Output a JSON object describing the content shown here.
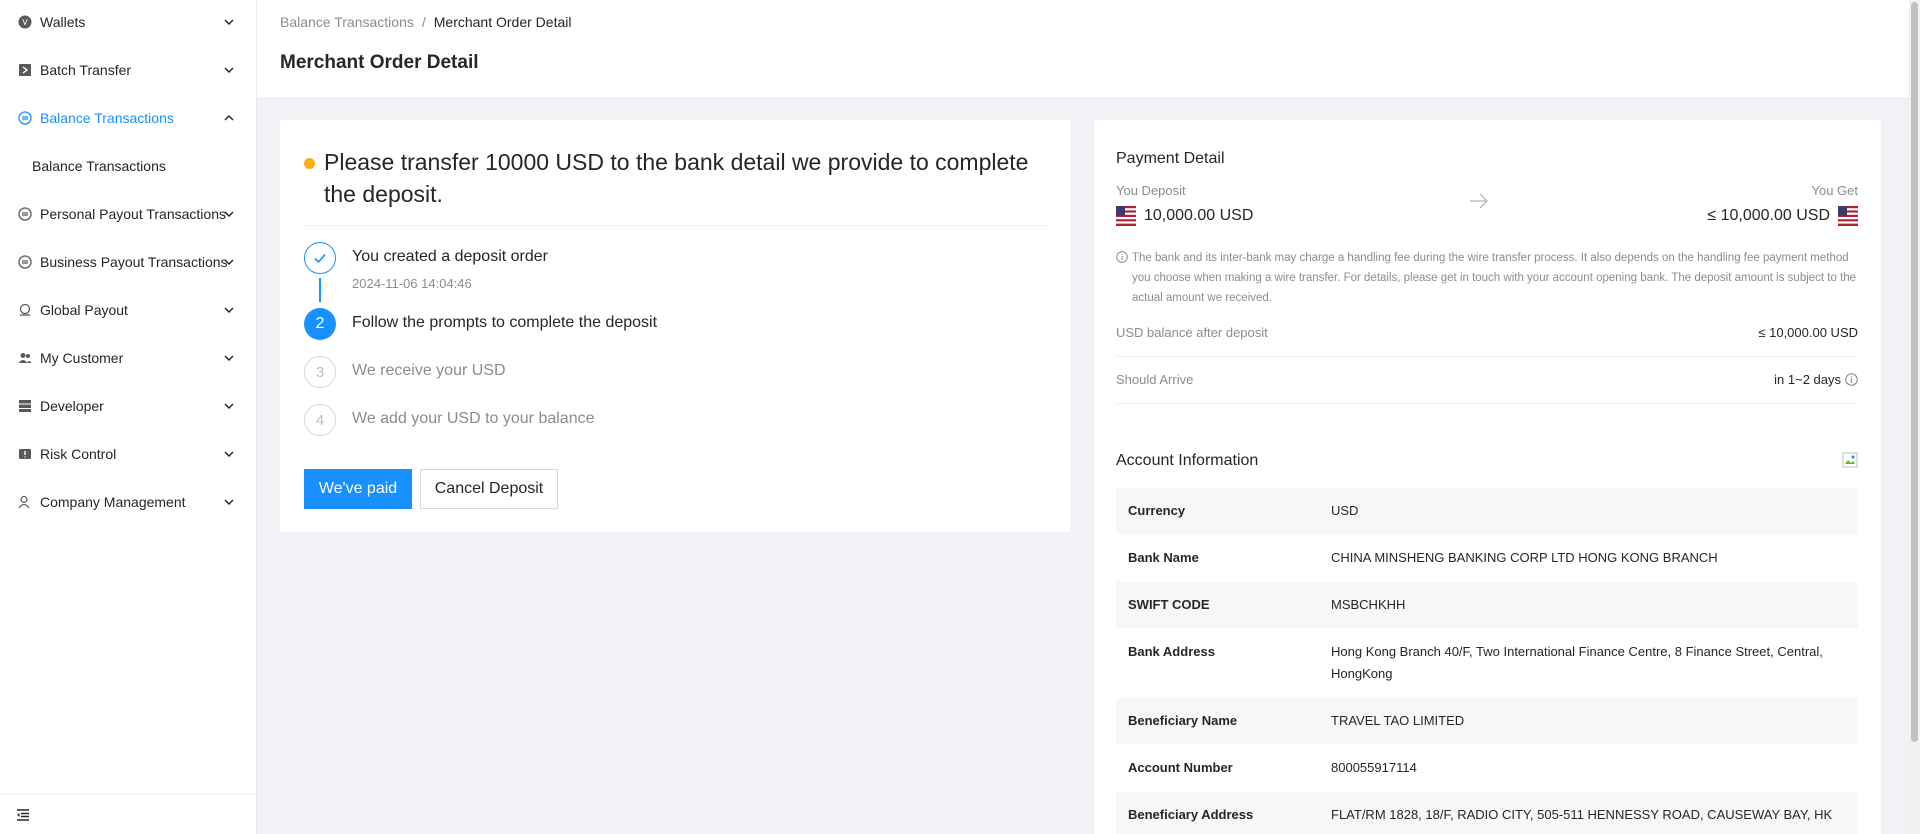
{
  "sidebar": {
    "items": [
      {
        "label": "Wallets",
        "icon": "wallet-icon"
      },
      {
        "label": "Batch Transfer",
        "icon": "batch-transfer-icon"
      },
      {
        "label": "Balance Transactions",
        "icon": "balance-icon",
        "active": true
      },
      {
        "label": "Personal Payout Transactions",
        "icon": "personal-payout-icon"
      },
      {
        "label": "Business Payout Transactions",
        "icon": "business-payout-icon"
      },
      {
        "label": "Global Payout",
        "icon": "global-payout-icon"
      },
      {
        "label": "My Customer",
        "icon": "customer-icon"
      },
      {
        "label": "Developer",
        "icon": "developer-icon"
      },
      {
        "label": "Risk Control",
        "icon": "risk-control-icon"
      },
      {
        "label": "Company Management",
        "icon": "company-icon"
      }
    ],
    "sub_item": "Balance Transactions"
  },
  "breadcrumb": {
    "parent": "Balance Transactions",
    "separator": "/",
    "current": "Merchant Order Detail"
  },
  "page_title": "Merchant Order Detail",
  "deposit": {
    "notice": "Please transfer 10000 USD to the bank detail we provide to complete the deposit.",
    "steps": [
      {
        "num": "1",
        "title": "You created a deposit order",
        "desc": "2024-11-06 14:04:46",
        "status": "done"
      },
      {
        "num": "2",
        "title": "Follow the prompts to complete the deposit",
        "status": "process"
      },
      {
        "num": "3",
        "title": "We receive your USD",
        "status": "wait"
      },
      {
        "num": "4",
        "title": "We add your USD to your balance",
        "status": "wait"
      }
    ],
    "paid_label": "We've paid",
    "cancel_label": "Cancel Deposit"
  },
  "payment": {
    "title": "Payment Detail",
    "you_deposit_label": "You Deposit",
    "you_deposit_value": "10,000.00 USD",
    "you_get_label": "You Get",
    "you_get_value": "≤ 10,000.00 USD",
    "fee_note": "The bank and its inter-bank may charge a handling fee during the wire transfer process. It also depends on the handling fee payment method you choose when making a wire transfer. For details, please get in touch with your account opening bank. The deposit amount is subject to the actual amount we received.",
    "balance_after_label": "USD balance after deposit",
    "balance_after_value": "≤ 10,000.00 USD",
    "arrive_label": "Should Arrive",
    "arrive_value": "in 1~2 days"
  },
  "account": {
    "title": "Account Information",
    "rows": [
      {
        "k": "Currency",
        "v": "USD"
      },
      {
        "k": "Bank Name",
        "v": "CHINA MINSHENG BANKING CORP LTD HONG KONG BRANCH"
      },
      {
        "k": "SWIFT CODE",
        "v": "MSBCHKHH"
      },
      {
        "k": "Bank Address",
        "v": "Hong Kong Branch 40/F, Two International Finance Centre, 8 Finance Street, Central, HongKong"
      },
      {
        "k": "Beneficiary Name",
        "v": "TRAVEL TAO LIMITED"
      },
      {
        "k": "Account Number",
        "v": "800055917114"
      },
      {
        "k": "Beneficiary Address",
        "v": "FLAT/RM 1828, 18/F, RADIO CITY, 505-511 HENNESSY ROAD, CAUSEWAY BAY, HK"
      }
    ]
  },
  "colors": {
    "primary": "#1890ff",
    "warning": "#faad14",
    "text": "#262626",
    "muted": "#8c8c8c"
  }
}
